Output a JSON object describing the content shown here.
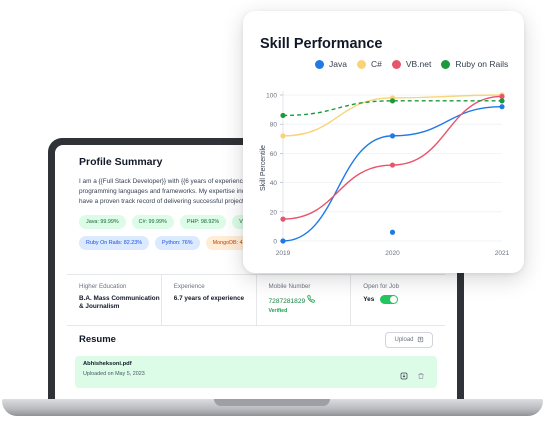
{
  "profile": {
    "title": "Profile Summary",
    "summary_lines": [
      "I am a {{Full Stack Developer}} with {{6 years of experience",
      "programming languages and frameworks. My expertise inc",
      "have a proven track record of delivering successful project"
    ],
    "chips_row1": [
      "Java: 99.99%",
      "C#: 99.99%",
      "PHP: 98.92%",
      "VB"
    ],
    "chips_row2": [
      "Ruby On Rails: 82.23%",
      "Python: 76%",
      "MongoDB: 4"
    ]
  },
  "info": {
    "education_label": "Higher Education",
    "education_value": "B.A. Mass Communication & Journalism",
    "experience_label": "Experience",
    "experience_value": "6.7 years of experience",
    "mobile_label": "Mobile Number",
    "mobile_value": "7287281829",
    "mobile_status": "Verified",
    "job_label": "Open for Job",
    "job_value": "Yes"
  },
  "resume": {
    "title": "Resume",
    "upload_label": "Upload",
    "file_name": "Abhisheksoni.pdf",
    "file_date": "Uploaded on May 5, 2023"
  },
  "icons": [
    "phone-icon",
    "upload-icon",
    "download-icon",
    "trash-icon"
  ],
  "colors": {
    "java": "#1f7ae8",
    "csharp": "#f8d477",
    "vbnet": "#e8546b",
    "ruby": "#1a7a36",
    "accent_green": "#22c55e"
  },
  "chart_data": {
    "type": "line",
    "title": "Skill Performance",
    "ylabel": "Skill Percentile",
    "xlabel": "",
    "x_ticks": [
      "2019",
      "2020",
      "2021"
    ],
    "y_ticks": [
      0,
      20,
      40,
      60,
      80,
      100
    ],
    "xlim": [
      2019,
      2021
    ],
    "ylim": [
      0,
      100
    ],
    "legend_position": "top",
    "series": [
      {
        "name": "Java",
        "color": "#1f7ae8",
        "style": "solid",
        "x": [
          2019,
          2020,
          2021
        ],
        "y": [
          0,
          72,
          92
        ]
      },
      {
        "name": "C#",
        "color": "#f8d477",
        "style": "solid",
        "x": [
          2019,
          2020,
          2021
        ],
        "y": [
          72,
          98,
          100
        ]
      },
      {
        "name": "VB.net",
        "color": "#e8546b",
        "style": "solid",
        "x": [
          2019,
          2020,
          2021
        ],
        "y": [
          15,
          52,
          99
        ]
      },
      {
        "name": "Ruby on Rails",
        "color": "#1a9a3c",
        "style": "dashed",
        "x": [
          2019,
          2020,
          2021
        ],
        "y": [
          86,
          96,
          96
        ]
      }
    ],
    "extra_points": [
      {
        "series": "Java",
        "x": 2020,
        "y": 6
      }
    ]
  }
}
